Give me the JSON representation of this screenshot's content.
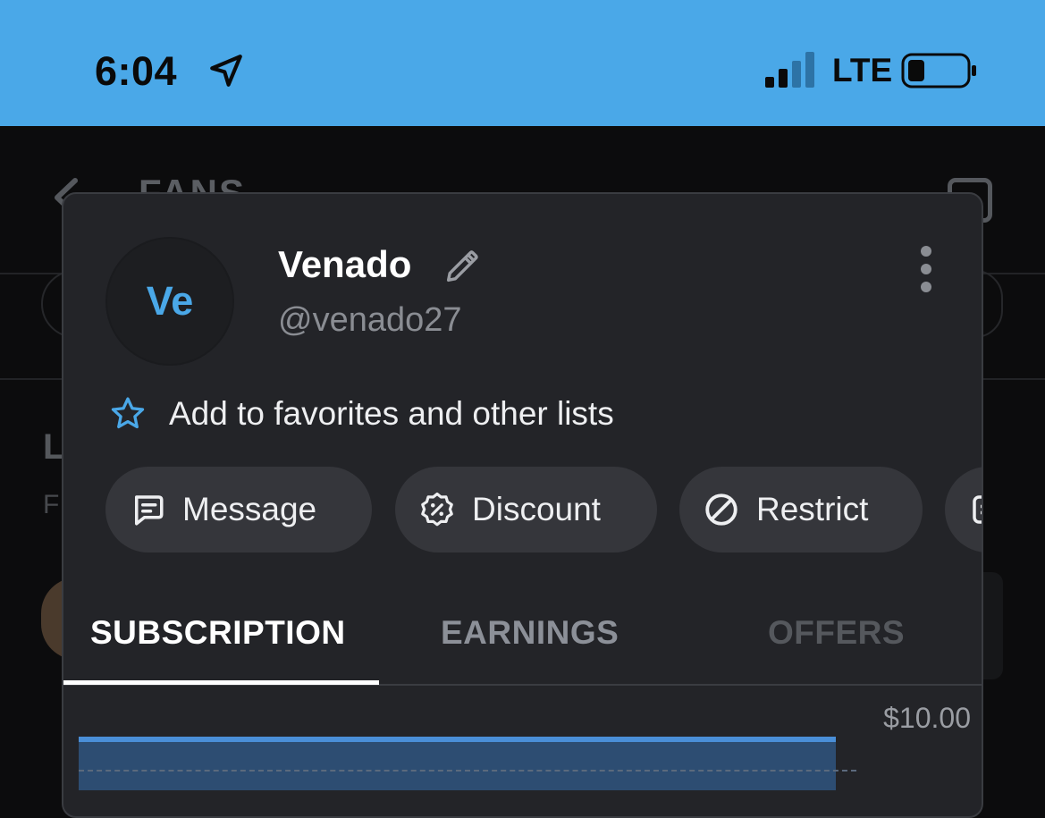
{
  "status_bar": {
    "time": "6:04",
    "network": "LTE",
    "location_icon": "location-arrow-icon",
    "signal_icon": "cellular-signal-icon",
    "battery_icon": "battery-low-icon",
    "background_color": "#4aa8e8"
  },
  "background_page": {
    "title": "FANS",
    "heading_fragment": "L",
    "subheading_fragment": "F"
  },
  "profile": {
    "initials": "Ve",
    "name": "Venado",
    "username": "@venado27",
    "accent_color": "#4aa8e8"
  },
  "favorites": {
    "label": "Add to favorites and other lists"
  },
  "actions": [
    {
      "label": "Message",
      "icon": "message-icon"
    },
    {
      "label": "Discount",
      "icon": "discount-badge-icon"
    },
    {
      "label": "Restrict",
      "icon": "restrict-icon"
    }
  ],
  "tabs": [
    {
      "label": "SUBSCRIPTION",
      "active": true
    },
    {
      "label": "EARNINGS",
      "active": false
    },
    {
      "label": "OFFERS",
      "active": false
    }
  ],
  "subscription": {
    "price": "$10.00"
  }
}
